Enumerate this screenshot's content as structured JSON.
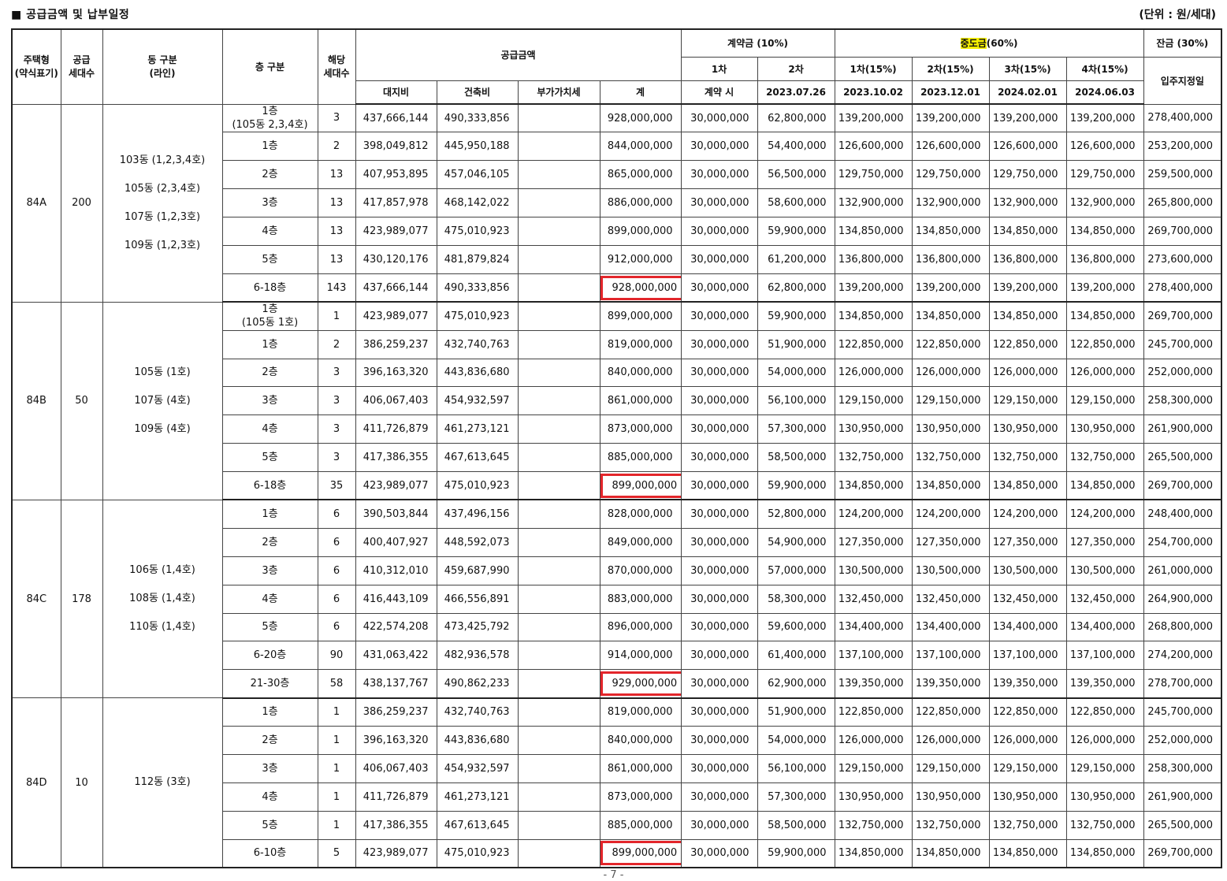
{
  "header": {
    "title": "■ 공급금액 및 납부일정",
    "unit": "(단위 : 원/세대)"
  },
  "columns": {
    "type": [
      "주택형",
      "(약식표기)"
    ],
    "supply_units": [
      "공급",
      "세대수"
    ],
    "dong": [
      "동 구분",
      "(라인)"
    ],
    "floor": "층 구분",
    "units": [
      "해당",
      "세대수"
    ],
    "supply_amount": "공급금액",
    "land": "대지비",
    "building": "건축비",
    "vat": "부가가치세",
    "total": "계",
    "deposit": "계약금 (10%)",
    "deposit_1": "1차",
    "deposit_2": "2차",
    "deposit_1_date": "계약 시",
    "deposit_2_date": "2023.07.26",
    "mid": "중도금",
    "mid_suffix": "(60%)",
    "mid_1": "1차(15%)",
    "mid_2": "2차(15%)",
    "mid_3": "3차(15%)",
    "mid_4": "4차(15%)",
    "mid_1_date": "2023.10.02",
    "mid_2_date": "2023.12.01",
    "mid_3_date": "2024.02.01",
    "mid_4_date": "2024.06.03",
    "balance": "잔금 (30%)",
    "balance_date": "입주지정일"
  },
  "groups": [
    {
      "type": "84A",
      "supply_units": "200",
      "dong_lines": [
        "103동 (1,2,3,4호)",
        "105동 (2,3,4호)",
        "107동 (1,2,3호)",
        "109동 (1,2,3호)"
      ],
      "rows": [
        {
          "floor": "1층",
          "floor_sub": "(105동 2,3,4호)",
          "units": "3",
          "land": "437,666,144",
          "building": "490,333,856",
          "vat": "",
          "total": "928,000,000",
          "d1": "30,000,000",
          "d2": "62,800,000",
          "m1": "139,200,000",
          "m2": "139,200,000",
          "m3": "139,200,000",
          "m4": "139,200,000",
          "bal": "278,400,000",
          "highlight": false
        },
        {
          "floor": "1층",
          "units": "2",
          "land": "398,049,812",
          "building": "445,950,188",
          "vat": "",
          "total": "844,000,000",
          "d1": "30,000,000",
          "d2": "54,400,000",
          "m1": "126,600,000",
          "m2": "126,600,000",
          "m3": "126,600,000",
          "m4": "126,600,000",
          "bal": "253,200,000",
          "highlight": false
        },
        {
          "floor": "2층",
          "units": "13",
          "land": "407,953,895",
          "building": "457,046,105",
          "vat": "",
          "total": "865,000,000",
          "d1": "30,000,000",
          "d2": "56,500,000",
          "m1": "129,750,000",
          "m2": "129,750,000",
          "m3": "129,750,000",
          "m4": "129,750,000",
          "bal": "259,500,000",
          "highlight": false
        },
        {
          "floor": "3층",
          "units": "13",
          "land": "417,857,978",
          "building": "468,142,022",
          "vat": "",
          "total": "886,000,000",
          "d1": "30,000,000",
          "d2": "58,600,000",
          "m1": "132,900,000",
          "m2": "132,900,000",
          "m3": "132,900,000",
          "m4": "132,900,000",
          "bal": "265,800,000",
          "highlight": false
        },
        {
          "floor": "4층",
          "units": "13",
          "land": "423,989,077",
          "building": "475,010,923",
          "vat": "",
          "total": "899,000,000",
          "d1": "30,000,000",
          "d2": "59,900,000",
          "m1": "134,850,000",
          "m2": "134,850,000",
          "m3": "134,850,000",
          "m4": "134,850,000",
          "bal": "269,700,000",
          "highlight": false
        },
        {
          "floor": "5층",
          "units": "13",
          "land": "430,120,176",
          "building": "481,879,824",
          "vat": "",
          "total": "912,000,000",
          "d1": "30,000,000",
          "d2": "61,200,000",
          "m1": "136,800,000",
          "m2": "136,800,000",
          "m3": "136,800,000",
          "m4": "136,800,000",
          "bal": "273,600,000",
          "highlight": false
        },
        {
          "floor": "6-18층",
          "units": "143",
          "land": "437,666,144",
          "building": "490,333,856",
          "vat": "",
          "total": "928,000,000",
          "d1": "30,000,000",
          "d2": "62,800,000",
          "m1": "139,200,000",
          "m2": "139,200,000",
          "m3": "139,200,000",
          "m4": "139,200,000",
          "bal": "278,400,000",
          "highlight": true
        }
      ]
    },
    {
      "type": "84B",
      "supply_units": "50",
      "dong_lines": [
        "105동 (1호)",
        "107동 (4호)",
        "109동 (4호)"
      ],
      "rows": [
        {
          "floor": "1층",
          "floor_sub": "(105동 1호)",
          "units": "1",
          "land": "423,989,077",
          "building": "475,010,923",
          "vat": "",
          "total": "899,000,000",
          "d1": "30,000,000",
          "d2": "59,900,000",
          "m1": "134,850,000",
          "m2": "134,850,000",
          "m3": "134,850,000",
          "m4": "134,850,000",
          "bal": "269,700,000",
          "highlight": false
        },
        {
          "floor": "1층",
          "units": "2",
          "land": "386,259,237",
          "building": "432,740,763",
          "vat": "",
          "total": "819,000,000",
          "d1": "30,000,000",
          "d2": "51,900,000",
          "m1": "122,850,000",
          "m2": "122,850,000",
          "m3": "122,850,000",
          "m4": "122,850,000",
          "bal": "245,700,000",
          "highlight": false
        },
        {
          "floor": "2층",
          "units": "3",
          "land": "396,163,320",
          "building": "443,836,680",
          "vat": "",
          "total": "840,000,000",
          "d1": "30,000,000",
          "d2": "54,000,000",
          "m1": "126,000,000",
          "m2": "126,000,000",
          "m3": "126,000,000",
          "m4": "126,000,000",
          "bal": "252,000,000",
          "highlight": false
        },
        {
          "floor": "3층",
          "units": "3",
          "land": "406,067,403",
          "building": "454,932,597",
          "vat": "",
          "total": "861,000,000",
          "d1": "30,000,000",
          "d2": "56,100,000",
          "m1": "129,150,000",
          "m2": "129,150,000",
          "m3": "129,150,000",
          "m4": "129,150,000",
          "bal": "258,300,000",
          "highlight": false
        },
        {
          "floor": "4층",
          "units": "3",
          "land": "411,726,879",
          "building": "461,273,121",
          "vat": "",
          "total": "873,000,000",
          "d1": "30,000,000",
          "d2": "57,300,000",
          "m1": "130,950,000",
          "m2": "130,950,000",
          "m3": "130,950,000",
          "m4": "130,950,000",
          "bal": "261,900,000",
          "highlight": false
        },
        {
          "floor": "5층",
          "units": "3",
          "land": "417,386,355",
          "building": "467,613,645",
          "vat": "",
          "total": "885,000,000",
          "d1": "30,000,000",
          "d2": "58,500,000",
          "m1": "132,750,000",
          "m2": "132,750,000",
          "m3": "132,750,000",
          "m4": "132,750,000",
          "bal": "265,500,000",
          "highlight": false
        },
        {
          "floor": "6-18층",
          "units": "35",
          "land": "423,989,077",
          "building": "475,010,923",
          "vat": "",
          "total": "899,000,000",
          "d1": "30,000,000",
          "d2": "59,900,000",
          "m1": "134,850,000",
          "m2": "134,850,000",
          "m3": "134,850,000",
          "m4": "134,850,000",
          "bal": "269,700,000",
          "highlight": true
        }
      ]
    },
    {
      "type": "84C",
      "supply_units": "178",
      "dong_lines": [
        "106동 (1,4호)",
        "108동 (1,4호)",
        "110동 (1,4호)"
      ],
      "rows": [
        {
          "floor": "1층",
          "units": "6",
          "land": "390,503,844",
          "building": "437,496,156",
          "vat": "",
          "total": "828,000,000",
          "d1": "30,000,000",
          "d2": "52,800,000",
          "m1": "124,200,000",
          "m2": "124,200,000",
          "m3": "124,200,000",
          "m4": "124,200,000",
          "bal": "248,400,000",
          "highlight": false
        },
        {
          "floor": "2층",
          "units": "6",
          "land": "400,407,927",
          "building": "448,592,073",
          "vat": "",
          "total": "849,000,000",
          "d1": "30,000,000",
          "d2": "54,900,000",
          "m1": "127,350,000",
          "m2": "127,350,000",
          "m3": "127,350,000",
          "m4": "127,350,000",
          "bal": "254,700,000",
          "highlight": false
        },
        {
          "floor": "3층",
          "units": "6",
          "land": "410,312,010",
          "building": "459,687,990",
          "vat": "",
          "total": "870,000,000",
          "d1": "30,000,000",
          "d2": "57,000,000",
          "m1": "130,500,000",
          "m2": "130,500,000",
          "m3": "130,500,000",
          "m4": "130,500,000",
          "bal": "261,000,000",
          "highlight": false
        },
        {
          "floor": "4층",
          "units": "6",
          "land": "416,443,109",
          "building": "466,556,891",
          "vat": "",
          "total": "883,000,000",
          "d1": "30,000,000",
          "d2": "58,300,000",
          "m1": "132,450,000",
          "m2": "132,450,000",
          "m3": "132,450,000",
          "m4": "132,450,000",
          "bal": "264,900,000",
          "highlight": false
        },
        {
          "floor": "5층",
          "units": "6",
          "land": "422,574,208",
          "building": "473,425,792",
          "vat": "",
          "total": "896,000,000",
          "d1": "30,000,000",
          "d2": "59,600,000",
          "m1": "134,400,000",
          "m2": "134,400,000",
          "m3": "134,400,000",
          "m4": "134,400,000",
          "bal": "268,800,000",
          "highlight": false
        },
        {
          "floor": "6-20층",
          "units": "90",
          "land": "431,063,422",
          "building": "482,936,578",
          "vat": "",
          "total": "914,000,000",
          "d1": "30,000,000",
          "d2": "61,400,000",
          "m1": "137,100,000",
          "m2": "137,100,000",
          "m3": "137,100,000",
          "m4": "137,100,000",
          "bal": "274,200,000",
          "highlight": false
        },
        {
          "floor": "21-30층",
          "units": "58",
          "land": "438,137,767",
          "building": "490,862,233",
          "vat": "",
          "total": "929,000,000",
          "d1": "30,000,000",
          "d2": "62,900,000",
          "m1": "139,350,000",
          "m2": "139,350,000",
          "m3": "139,350,000",
          "m4": "139,350,000",
          "bal": "278,700,000",
          "highlight": true
        }
      ]
    },
    {
      "type": "84D",
      "supply_units": "10",
      "dong_lines": [
        "112동 (3호)"
      ],
      "rows": [
        {
          "floor": "1층",
          "units": "1",
          "land": "386,259,237",
          "building": "432,740,763",
          "vat": "",
          "total": "819,000,000",
          "d1": "30,000,000",
          "d2": "51,900,000",
          "m1": "122,850,000",
          "m2": "122,850,000",
          "m3": "122,850,000",
          "m4": "122,850,000",
          "bal": "245,700,000",
          "highlight": false
        },
        {
          "floor": "2층",
          "units": "1",
          "land": "396,163,320",
          "building": "443,836,680",
          "vat": "",
          "total": "840,000,000",
          "d1": "30,000,000",
          "d2": "54,000,000",
          "m1": "126,000,000",
          "m2": "126,000,000",
          "m3": "126,000,000",
          "m4": "126,000,000",
          "bal": "252,000,000",
          "highlight": false
        },
        {
          "floor": "3층",
          "units": "1",
          "land": "406,067,403",
          "building": "454,932,597",
          "vat": "",
          "total": "861,000,000",
          "d1": "30,000,000",
          "d2": "56,100,000",
          "m1": "129,150,000",
          "m2": "129,150,000",
          "m3": "129,150,000",
          "m4": "129,150,000",
          "bal": "258,300,000",
          "highlight": false
        },
        {
          "floor": "4층",
          "units": "1",
          "land": "411,726,879",
          "building": "461,273,121",
          "vat": "",
          "total": "873,000,000",
          "d1": "30,000,000",
          "d2": "57,300,000",
          "m1": "130,950,000",
          "m2": "130,950,000",
          "m3": "130,950,000",
          "m4": "130,950,000",
          "bal": "261,900,000",
          "highlight": false
        },
        {
          "floor": "5층",
          "units": "1",
          "land": "417,386,355",
          "building": "467,613,645",
          "vat": "",
          "total": "885,000,000",
          "d1": "30,000,000",
          "d2": "58,500,000",
          "m1": "132,750,000",
          "m2": "132,750,000",
          "m3": "132,750,000",
          "m4": "132,750,000",
          "bal": "265,500,000",
          "highlight": false
        },
        {
          "floor": "6-10층",
          "units": "5",
          "land": "423,989,077",
          "building": "475,010,923",
          "vat": "",
          "total": "899,000,000",
          "d1": "30,000,000",
          "d2": "59,900,000",
          "m1": "134,850,000",
          "m2": "134,850,000",
          "m3": "134,850,000",
          "m4": "134,850,000",
          "bal": "269,700,000",
          "highlight": true
        }
      ]
    }
  ],
  "footer": {
    "page": "- 7 -"
  },
  "colors": {
    "highlight_box": "#e3262b",
    "mid_highlight": "#f6f000"
  }
}
